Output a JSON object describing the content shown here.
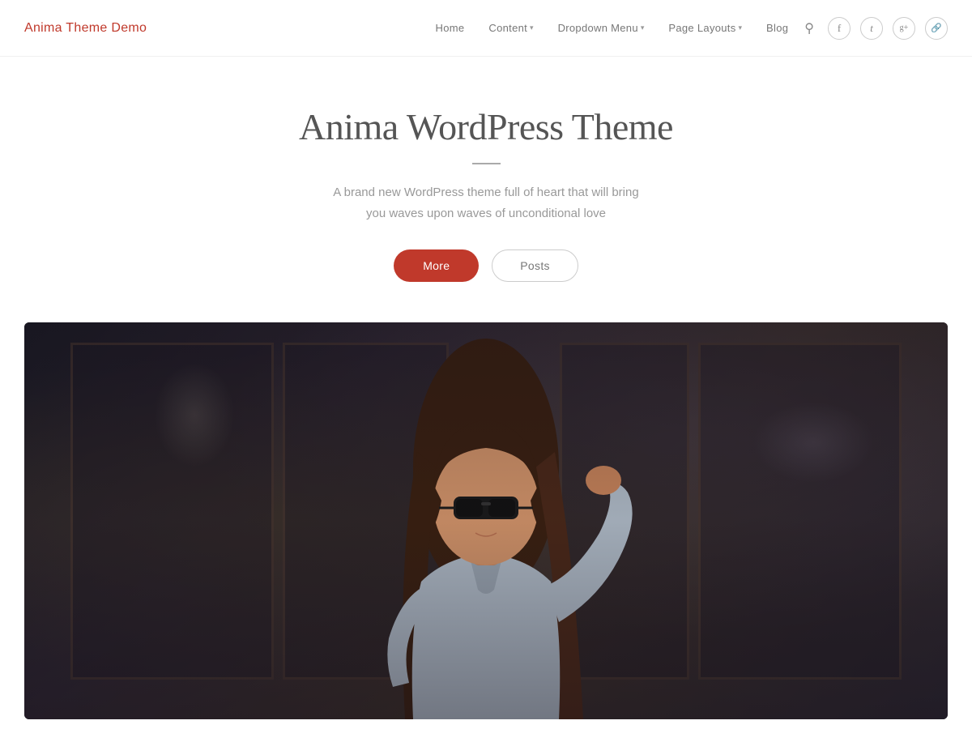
{
  "header": {
    "site_title": "Anima Theme Demo",
    "nav": {
      "items": [
        {
          "label": "Home",
          "has_dropdown": false
        },
        {
          "label": "Content",
          "has_dropdown": true
        },
        {
          "label": "Dropdown Menu",
          "has_dropdown": true
        },
        {
          "label": "Page Layouts",
          "has_dropdown": true
        },
        {
          "label": "Blog",
          "has_dropdown": false
        }
      ]
    },
    "social_icons": [
      {
        "name": "search",
        "symbol": "🔍"
      },
      {
        "name": "facebook",
        "symbol": "f"
      },
      {
        "name": "twitter",
        "symbol": "t"
      },
      {
        "name": "google-plus",
        "symbol": "g+"
      },
      {
        "name": "link",
        "symbol": "🔗"
      }
    ]
  },
  "hero": {
    "title": "Anima WordPress Theme",
    "subtitle_line1": "A brand new WordPress theme full of heart that will bring",
    "subtitle_line2": "you waves upon waves of unconditional love",
    "btn_more": "More",
    "btn_posts": "Posts"
  },
  "colors": {
    "accent_red": "#c0392b",
    "text_dark": "#555555",
    "text_light": "#999999",
    "nav_text": "#777777",
    "border": "#cccccc"
  }
}
